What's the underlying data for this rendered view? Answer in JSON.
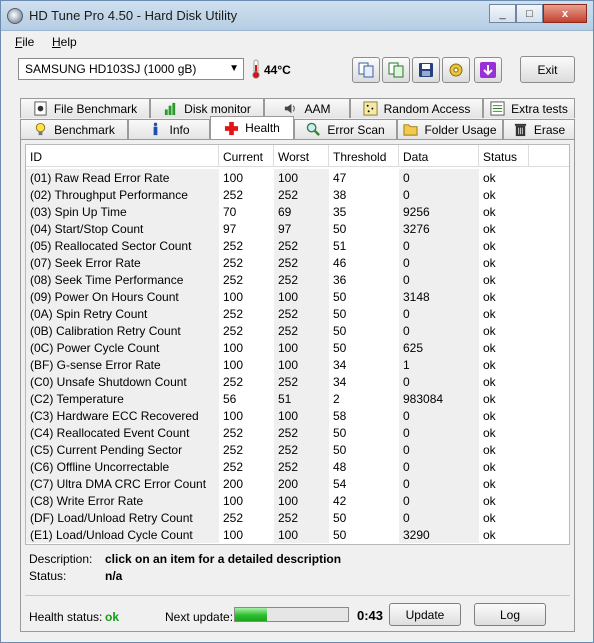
{
  "window": {
    "title": "HD Tune Pro 4.50 - Hard Disk Utility",
    "controls": [
      "_",
      "□",
      "x"
    ]
  },
  "menu": [
    {
      "underline": "F",
      "rest": "ile"
    },
    {
      "underline": "H",
      "rest": "elp"
    }
  ],
  "toolbar": {
    "drive": "SAMSUNG HD103SJ (1000 gB)",
    "temperature": "44°C",
    "exit_label": "Exit",
    "icons": [
      "copy-info-icon",
      "copy-screenshot-icon",
      "save-icon",
      "options-icon",
      "download-icon"
    ]
  },
  "tabs": {
    "row1": [
      "File Benchmark",
      "Disk monitor",
      "AAM",
      "Random Access",
      "Extra tests"
    ],
    "row2": [
      "Benchmark",
      "Info",
      "Health",
      "Error Scan",
      "Folder Usage",
      "Erase"
    ],
    "active": "Health"
  },
  "grid": {
    "columns": [
      "ID",
      "Current",
      "Worst",
      "Threshold",
      "Data",
      "Status"
    ],
    "rows": [
      [
        "(01) Raw Read Error Rate",
        "100",
        "100",
        "47",
        "0",
        "ok"
      ],
      [
        "(02) Throughput Performance",
        "252",
        "252",
        "38",
        "0",
        "ok"
      ],
      [
        "(03) Spin Up Time",
        "70",
        "69",
        "35",
        "9256",
        "ok"
      ],
      [
        "(04) Start/Stop Count",
        "97",
        "97",
        "50",
        "3276",
        "ok"
      ],
      [
        "(05) Reallocated Sector Count",
        "252",
        "252",
        "51",
        "0",
        "ok"
      ],
      [
        "(07) Seek Error Rate",
        "252",
        "252",
        "46",
        "0",
        "ok"
      ],
      [
        "(08) Seek Time Performance",
        "252",
        "252",
        "36",
        "0",
        "ok"
      ],
      [
        "(09) Power On Hours Count",
        "100",
        "100",
        "50",
        "3148",
        "ok"
      ],
      [
        "(0A) Spin Retry Count",
        "252",
        "252",
        "50",
        "0",
        "ok"
      ],
      [
        "(0B) Calibration Retry Count",
        "252",
        "252",
        "50",
        "0",
        "ok"
      ],
      [
        "(0C) Power Cycle Count",
        "100",
        "100",
        "50",
        "625",
        "ok"
      ],
      [
        "(BF) G-sense Error Rate",
        "100",
        "100",
        "34",
        "1",
        "ok"
      ],
      [
        "(C0) Unsafe Shutdown Count",
        "252",
        "252",
        "34",
        "0",
        "ok"
      ],
      [
        "(C2) Temperature",
        "56",
        "51",
        "2",
        "983084",
        "ok"
      ],
      [
        "(C3) Hardware ECC Recovered",
        "100",
        "100",
        "58",
        "0",
        "ok"
      ],
      [
        "(C4) Reallocated Event Count",
        "252",
        "252",
        "50",
        "0",
        "ok"
      ],
      [
        "(C5) Current Pending Sector",
        "252",
        "252",
        "50",
        "0",
        "ok"
      ],
      [
        "(C6) Offline Uncorrectable",
        "252",
        "252",
        "48",
        "0",
        "ok"
      ],
      [
        "(C7) Ultra DMA CRC Error Count",
        "200",
        "200",
        "54",
        "0",
        "ok"
      ],
      [
        "(C8) Write Error Rate",
        "100",
        "100",
        "42",
        "0",
        "ok"
      ],
      [
        "(DF) Load/Unload Retry Count",
        "252",
        "252",
        "50",
        "0",
        "ok"
      ],
      [
        "(E1) Load/Unload Cycle Count",
        "100",
        "100",
        "50",
        "3290",
        "ok"
      ]
    ]
  },
  "details": {
    "description_label": "Description:",
    "description_value": "click on an item for a detailed description",
    "status_label": "Status:",
    "status_value": "n/a"
  },
  "footer": {
    "health_label": "Health status:",
    "health_value": "ok",
    "next_update_label": "Next update:",
    "progress_fraction": 0.28,
    "countdown": "0:43",
    "update_label": "Update",
    "log_label": "Log"
  }
}
